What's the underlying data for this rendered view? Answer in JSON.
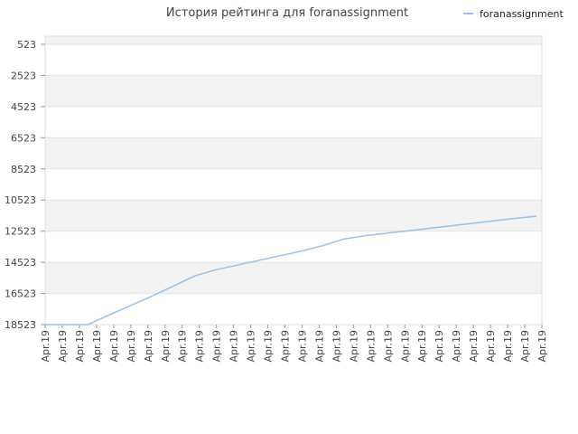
{
  "chart_data": {
    "type": "line",
    "title": "История рейтинга для foranassignment",
    "xlabel": "",
    "ylabel": "",
    "y_axis_inverted": true,
    "ylim": [
      523,
      18523
    ],
    "y_ticks": [
      523,
      2523,
      4523,
      6523,
      8523,
      10523,
      12523,
      14523,
      16523,
      18523
    ],
    "y_tick_labels": [
      "523",
      "2523",
      "4523",
      "6523",
      "8523",
      "10523",
      "12523",
      "14523",
      "16523",
      "18523"
    ],
    "x_tick_labels": [
      "Apr.19",
      "Apr.19",
      "Apr.19",
      "Apr.19",
      "Apr.19",
      "Apr.19",
      "Apr.19",
      "Apr.19",
      "Apr.19",
      "Apr.19",
      "Apr.19",
      "Apr.19",
      "Apr.19",
      "Apr.19",
      "Apr.19",
      "Apr.19",
      "Apr.19",
      "Apr.19",
      "Apr.19",
      "Apr.19",
      "Apr.19",
      "Apr.19",
      "Apr.19",
      "Apr.19",
      "Apr.19",
      "Apr.19",
      "Apr.19",
      "Apr.19",
      "Apr.19",
      "Apr.19"
    ],
    "grid": true,
    "legend_position": "top-right",
    "series": [
      {
        "name": "foranassignment",
        "color": "#95c2ee",
        "values": [
          18523,
          18523,
          18523,
          17900,
          17300,
          16700,
          16050,
          15400,
          15000,
          14700,
          14400,
          14100,
          13800,
          13450,
          13020,
          12820,
          12650,
          12500,
          12340,
          12180,
          12020,
          11860,
          11700,
          11560
        ]
      }
    ]
  }
}
